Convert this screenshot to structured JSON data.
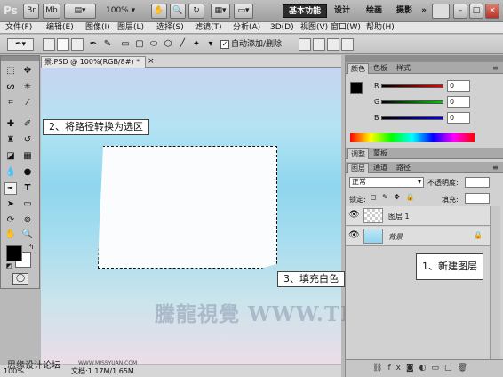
{
  "titlebar": {
    "app_logo": "Ps",
    "buttons": [
      "Br",
      "Mb"
    ],
    "zoom_label": "100%",
    "workspaces": [
      "基本功能",
      "设计",
      "绘画",
      "摄影"
    ],
    "more": "»"
  },
  "menubar": {
    "items": [
      "文件(F)",
      "编辑(E)",
      "图像(I)",
      "图层(L)",
      "选择(S)",
      "滤镜(T)",
      "分析(A)",
      "3D(D)",
      "视图(V)",
      "窗口(W)",
      "帮助(H)"
    ]
  },
  "options": {
    "auto_add_delete_label": "自动添加/删除",
    "auto_add_delete_checked": true
  },
  "document": {
    "tab_title": "景.PSD @ 100%(RGB/8#) *",
    "tab_close": "×",
    "zoom": "100%",
    "doc_size": "文档:1.17M/1.65M"
  },
  "panels": {
    "color_tabs": [
      "颜色",
      "色板",
      "样式"
    ],
    "channels": [
      {
        "label": "R",
        "value": "0"
      },
      {
        "label": "G",
        "value": "0"
      },
      {
        "label": "B",
        "value": "0"
      }
    ],
    "adjust_tabs": [
      "调整",
      "蒙板"
    ],
    "layers_tabs": [
      "图层",
      "通道",
      "路径"
    ],
    "blend_mode": "正常",
    "opacity_label": "不透明度:",
    "lock_label": "锁定:",
    "fill_label": "填充:",
    "layers": [
      {
        "name": "图层 1",
        "locked": false
      },
      {
        "name": "背景",
        "locked": true
      }
    ]
  },
  "annotations": {
    "step1": "1、新建图层",
    "step2": "2、将路径转换为选区",
    "step3": "3、填充白色"
  },
  "watermarks": {
    "brand": "騰龍視覺 WWW.TLVI.NET",
    "forum": "思缘设计论坛",
    "site": "WWW.MISSYUAN.COM"
  },
  "colors": {
    "foreground": "#000000",
    "background": "#ffffff",
    "accent": "#1e5aa8"
  }
}
